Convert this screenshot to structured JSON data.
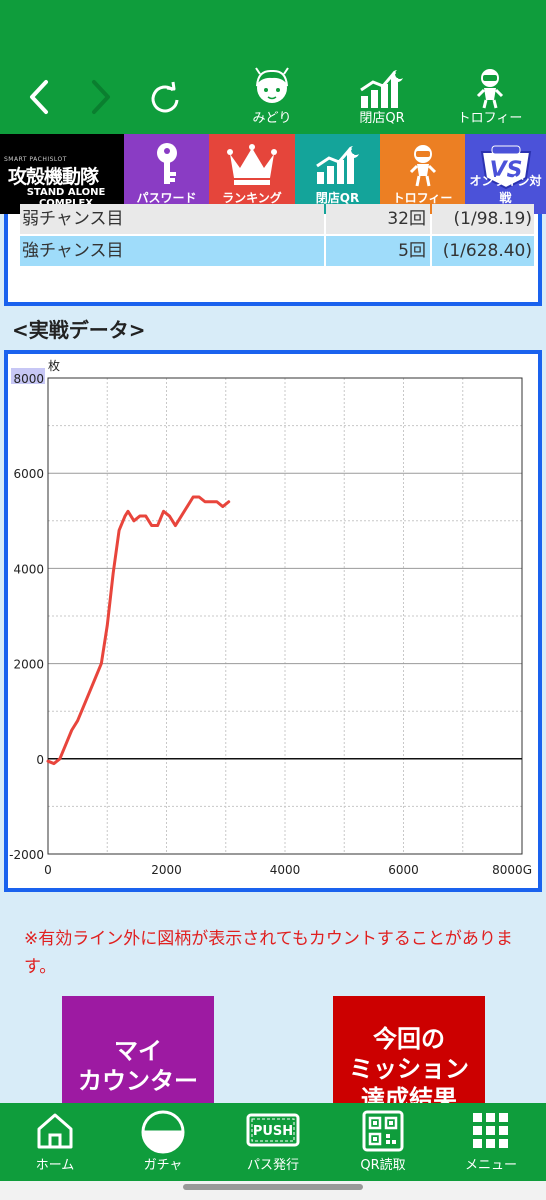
{
  "top_nav": {
    "items": [
      {
        "label": "みどり",
        "icon": "character-avatar-icon"
      },
      {
        "label": "閉店QR",
        "icon": "rising-chart-icon"
      },
      {
        "label": "トロフィー",
        "icon": "trophy-figure-icon"
      }
    ]
  },
  "categories": {
    "logo": {
      "small": "SMART PACHISLOT",
      "title": "攻殻機動隊",
      "subtitle": "STAND ALONE COMPLEX"
    },
    "items": [
      {
        "label": "パスワード",
        "icon": "key-icon",
        "color": "#8a3cc4"
      },
      {
        "label": "ランキング",
        "icon": "crown-icon",
        "color": "#e5453b"
      },
      {
        "label": "閉店QR",
        "icon": "rising-chart-icon",
        "color": "#14a49a"
      },
      {
        "label": "トロフィー",
        "icon": "trophy-figure-icon",
        "color": "#ec7f23"
      },
      {
        "label": "オンライン対戦",
        "icon": "vs-badge-icon",
        "color": "#4b52d9"
      }
    ]
  },
  "stats": {
    "rows": [
      {
        "name": "弱チャンス目",
        "count": "32回",
        "rate": "(1/98.19)"
      },
      {
        "name": "強チャンス目",
        "count": "5回",
        "rate": "(1/628.40)"
      }
    ]
  },
  "section": {
    "title": "<実戦データ>"
  },
  "chart_data": {
    "type": "line",
    "ylabel": "枚",
    "xlabel": "G",
    "xlim": [
      0,
      8000
    ],
    "ylim": [
      -2000,
      8000
    ],
    "x_ticks": [
      "0",
      "2000",
      "4000",
      "6000",
      "8000G"
    ],
    "y_ticks": [
      "8000",
      "6000",
      "4000",
      "2000",
      "0",
      "-2000"
    ],
    "grid": true,
    "series": [
      {
        "color": "#e8453c",
        "x": [
          0,
          100,
          200,
          300,
          400,
          500,
          600,
          700,
          800,
          900,
          1000,
          1100,
          1200,
          1300,
          1350,
          1450,
          1550,
          1650,
          1750,
          1850,
          1950,
          2050,
          2150,
          2250,
          2350,
          2450,
          2550,
          2650,
          2750,
          2850,
          2950,
          3050
        ],
        "y": [
          -50,
          -100,
          0,
          300,
          600,
          800,
          1100,
          1400,
          1700,
          2000,
          2800,
          3900,
          4800,
          5100,
          5200,
          5000,
          5100,
          5100,
          4900,
          4900,
          5200,
          5100,
          4900,
          5100,
          5300,
          5500,
          5500,
          5400,
          5400,
          5400,
          5300,
          5400
        ]
      }
    ]
  },
  "note": "※有効ライン外に図柄が表示されてもカウントすることがあります。",
  "buttons": {
    "counter": "マイ\nカウンター",
    "mission": "今回の\nミッション\n達成結果"
  },
  "bottom_nav": {
    "items": [
      {
        "label": "ホーム",
        "icon": "home-icon"
      },
      {
        "label": "ガチャ",
        "icon": "gacha-ball-icon"
      },
      {
        "label": "パス発行",
        "icon": "push-pass-icon"
      },
      {
        "label": "QR読取",
        "icon": "qr-code-icon"
      },
      {
        "label": "メニュー",
        "icon": "menu-grid-icon"
      }
    ]
  }
}
